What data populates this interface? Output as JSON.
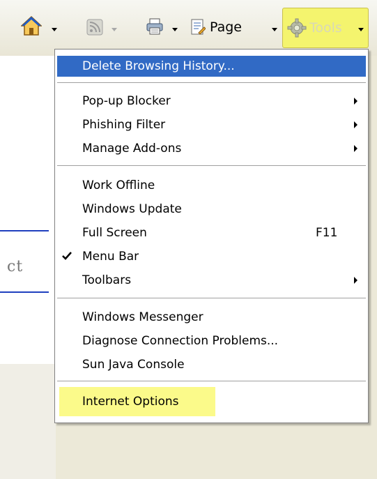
{
  "toolbar": {
    "page_label": "Page",
    "tools_label": "Tools"
  },
  "background": {
    "fragment_text": "ct"
  },
  "menu": {
    "items": [
      {
        "label": "Delete Browsing History..."
      },
      {
        "label": "Pop-up Blocker"
      },
      {
        "label": "Phishing Filter"
      },
      {
        "label": "Manage Add-ons"
      },
      {
        "label": "Work Offline"
      },
      {
        "label": "Windows Update"
      },
      {
        "label": "Full Screen",
        "shortcut": "F11"
      },
      {
        "label": "Menu Bar"
      },
      {
        "label": "Toolbars"
      },
      {
        "label": "Windows Messenger"
      },
      {
        "label": "Diagnose Connection Problems..."
      },
      {
        "label": "Sun Java Console"
      },
      {
        "label": "Internet Options"
      }
    ]
  },
  "colors": {
    "menu_highlight": "#316ac5",
    "tools_button": "#f4f46e",
    "annotation_highlight": "#fbfa8a"
  }
}
